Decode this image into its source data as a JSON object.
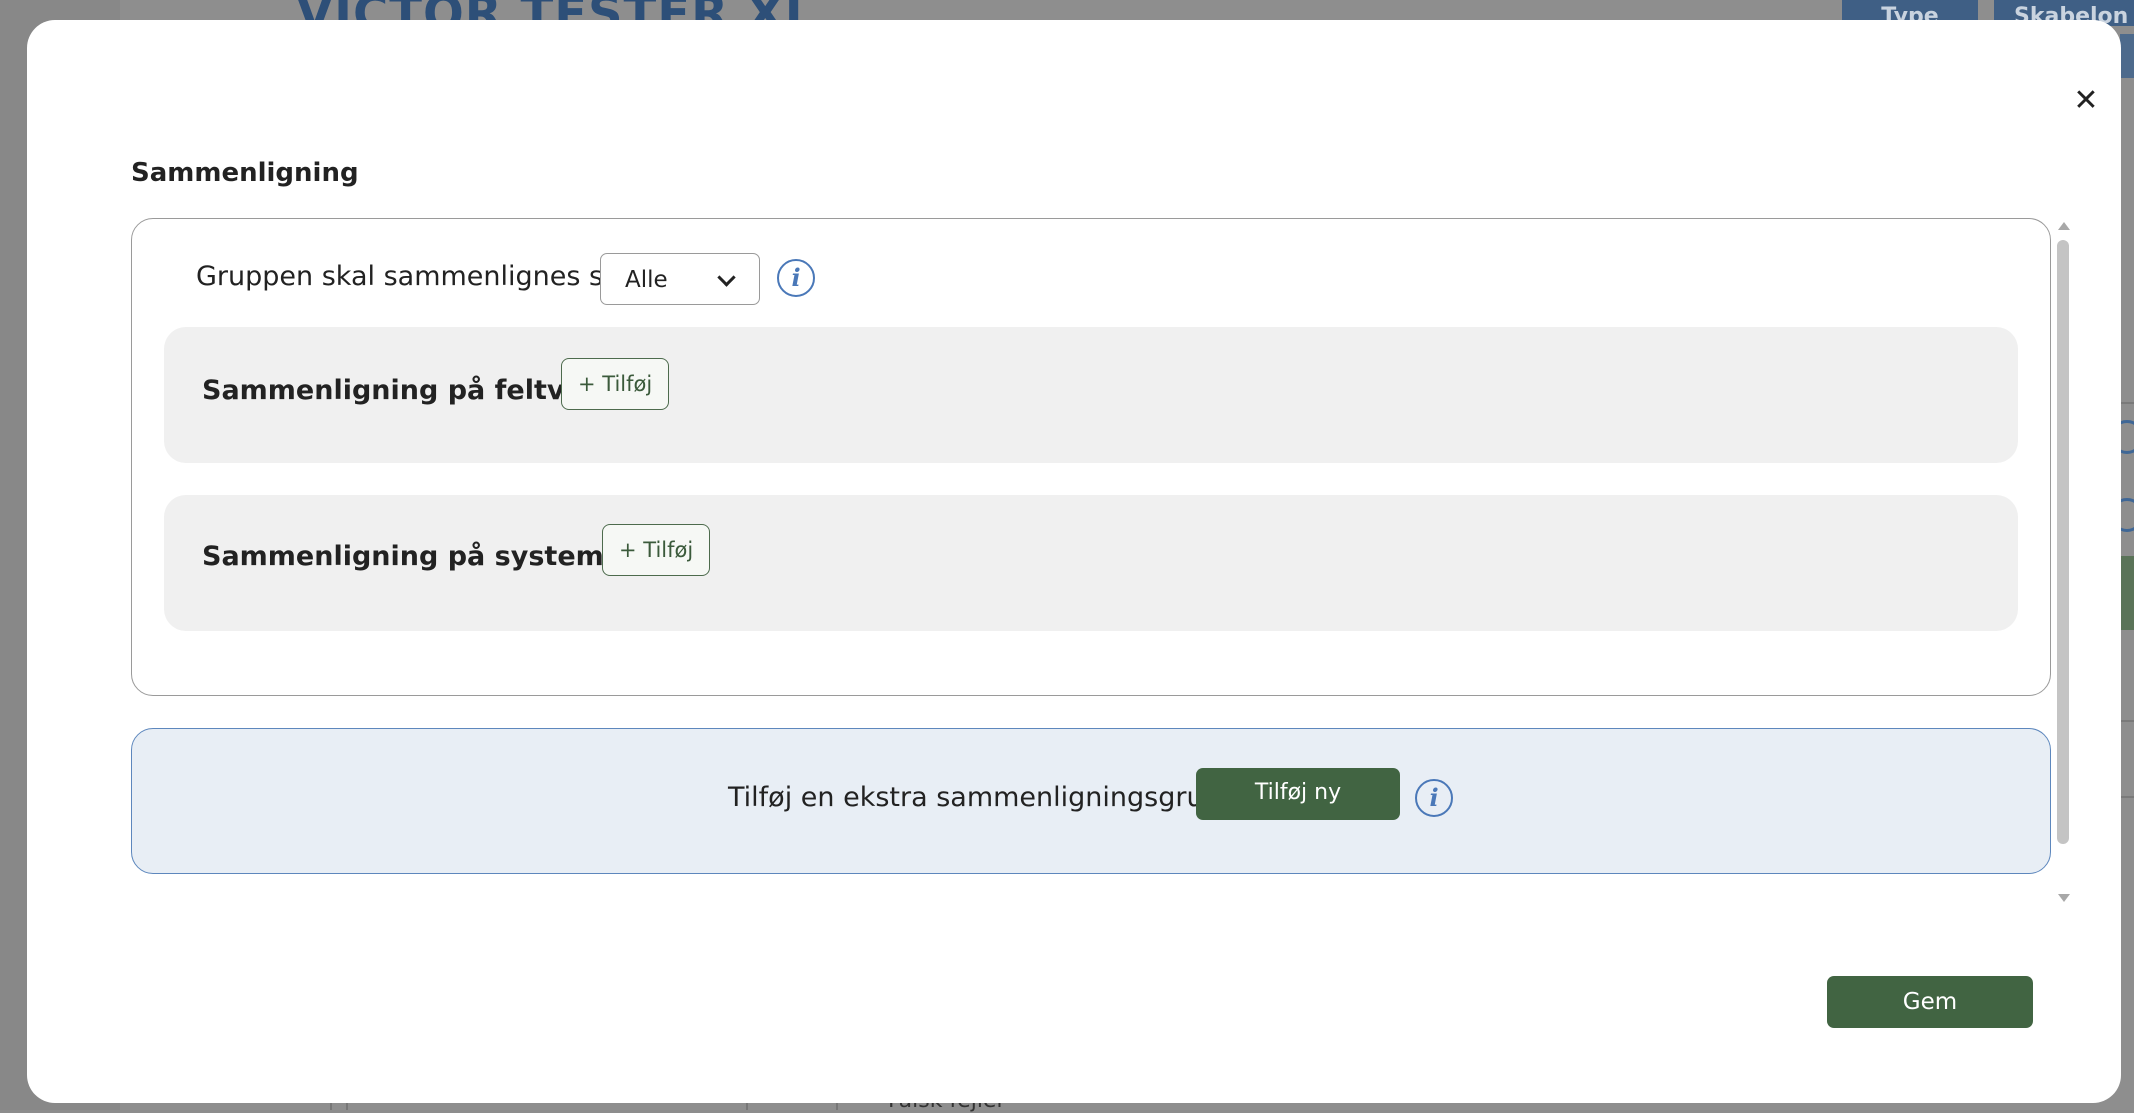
{
  "background": {
    "title": "VICTOR TESTER XI",
    "buttons": [
      "Type",
      "Skabelon Id"
    ],
    "bottom_text": "Falsk fejler"
  },
  "modal": {
    "close_icon": "close-icon",
    "title": "Sammenligning",
    "group": {
      "compare_label": "Gruppen skal sammenlignes som:",
      "compare_value": "Alle",
      "panels": [
        {
          "label": "Sammenligning på feltværdi",
          "add_label": "+ Tilføj"
        },
        {
          "label": "Sammenligning på systemværdi",
          "add_label": "+ Tilføj"
        }
      ]
    },
    "add_group": {
      "label": "Tilføj en ekstra sammenligningsgruppe",
      "button_label": "Tilføj ny"
    },
    "save_label": "Gem"
  },
  "colors": {
    "primary_green": "#416442",
    "info_blue": "#4a78b8",
    "add_group_bg": "#e8eef5",
    "panel_bg": "#f0f0f0"
  }
}
